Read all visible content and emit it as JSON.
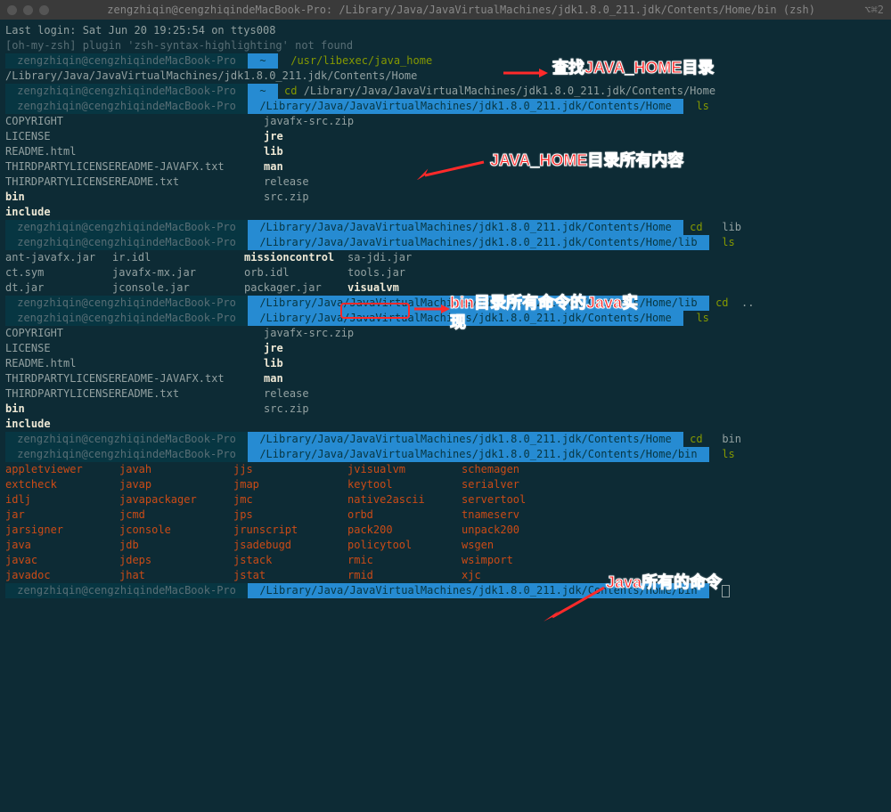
{
  "titlebar": {
    "title": "zengzhiqin@cengzhiqindeMacBook-Pro: /Library/Java/JavaVirtualMachines/jdk1.8.0_211.jdk/Contents/Home/bin (zsh)",
    "right": "⌥⌘2"
  },
  "prompt_host": "zengzhiqin@cengzhiqindeMacBook-Pro",
  "tilde": "~",
  "login_line": "Last login: Sat Jun 20 19:25:54 on ttys008",
  "plugin_line": "[oh-my-zsh] plugin 'zsh-syntax-highlighting' not found",
  "cmd_java_home": "/usr/libexec/java_home",
  "java_home_output": "/Library/Java/JavaVirtualMachines/jdk1.8.0_211.jdk/Contents/Home",
  "cmd_cd_home": "cd /Library/Java/JavaVirtualMachines/jdk1.8.0_211.jdk/Contents/Home",
  "path_home": "/Library/Java/JavaVirtualMachines/jdk1.8.0_211.jdk/Contents/Home",
  "path_lib": "/Library/Java/JavaVirtualMachines/jdk1.8.0_211.jdk/Contents/Home/lib",
  "path_bin": "/Library/Java/JavaVirtualMachines/jdk1.8.0_211.jdk/Contents/Home/bin",
  "cmd_ls": "ls",
  "cmd_cd_lib": "cd lib",
  "cmd_cd_up": "cd ..",
  "cmd_cd_bin": "cd bin",
  "ls_home": {
    "col_a": [
      "COPYRIGHT",
      "LICENSE",
      "README.html",
      "THIRDPARTYLICENSEREADME-JAVAFX.txt",
      "THIRDPARTYLICENSEREADME.txt",
      "bin",
      "include"
    ],
    "col_b": [
      "javafx-src.zip",
      "jre",
      "lib",
      "man",
      "release",
      "src.zip",
      ""
    ],
    "bold_idx_a": [
      5,
      6
    ],
    "bold_idx_b": [
      1,
      2,
      3
    ]
  },
  "ls_lib": {
    "rows": [
      [
        "ant-javafx.jar",
        "ir.idl",
        "missioncontrol",
        "sa-jdi.jar"
      ],
      [
        "ct.sym",
        "javafx-mx.jar",
        "orb.idl",
        "tools.jar"
      ],
      [
        "dt.jar",
        "jconsole.jar",
        "packager.jar",
        "visualvm"
      ]
    ],
    "bold": {
      "0": [
        2
      ],
      "2": [
        3
      ]
    }
  },
  "ls_bin": {
    "rows": [
      [
        "appletviewer",
        "javah",
        "jjs",
        "jvisualvm",
        "schemagen"
      ],
      [
        "extcheck",
        "javap",
        "jmap",
        "keytool",
        "serialver"
      ],
      [
        "idlj",
        "javapackager",
        "jmc",
        "native2ascii",
        "servertool"
      ],
      [
        "jar",
        "jcmd",
        "jps",
        "orbd",
        "tnameserv"
      ],
      [
        "jarsigner",
        "jconsole",
        "jrunscript",
        "pack200",
        "unpack200"
      ],
      [
        "java",
        "jdb",
        "jsadebugd",
        "policytool",
        "wsgen"
      ],
      [
        "javac",
        "jdeps",
        "jstack",
        "rmic",
        "wsimport"
      ],
      [
        "javadoc",
        "jhat",
        "jstat",
        "rmid",
        "xjc"
      ]
    ]
  },
  "annotations": {
    "a1": "查找JAVA_HOME目录",
    "a2": "JAVA_HOME目录所有内容",
    "a3_l1": "bin目录所有命令的Java实",
    "a3_l2": "现",
    "a4": "Java所有的命令"
  }
}
